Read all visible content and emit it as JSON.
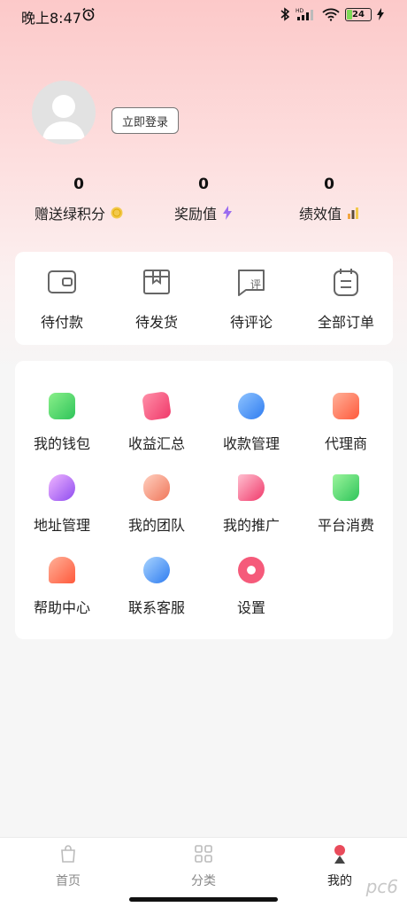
{
  "status_bar": {
    "time": "晚上8:47",
    "battery": "24",
    "network": "HD"
  },
  "profile": {
    "login_label": "立即登录"
  },
  "stats": [
    {
      "value": "0",
      "label": "赠送绿积分",
      "icon": "coin-icon",
      "color": "#f2c94c"
    },
    {
      "value": "0",
      "label": "奖励值",
      "icon": "lightning-icon",
      "color": "#9b6cf0"
    },
    {
      "value": "0",
      "label": "绩效值",
      "icon": "chart-icon",
      "color": "#f2a541"
    }
  ],
  "orders": [
    {
      "label": "待付款",
      "icon": "wallet-icon"
    },
    {
      "label": "待发货",
      "icon": "box-icon"
    },
    {
      "label": "待评论",
      "icon": "review-icon",
      "glyph": "评"
    },
    {
      "label": "全部订单",
      "icon": "order-list-icon"
    }
  ],
  "menu": [
    {
      "label": "我的钱包",
      "icon": "wallet-icon",
      "color": "#4cd964"
    },
    {
      "label": "收益汇总",
      "icon": "income-icon",
      "color": "#f5597e"
    },
    {
      "label": "收款管理",
      "icon": "payment-icon",
      "color": "#3d8bf5"
    },
    {
      "label": "代理商",
      "icon": "agent-icon",
      "color": "#ff7a5c"
    },
    {
      "label": "地址管理",
      "icon": "location-icon",
      "color": "#b06cf0"
    },
    {
      "label": "我的团队",
      "icon": "team-icon",
      "color": "#f39a7a"
    },
    {
      "label": "我的推广",
      "icon": "megaphone-icon",
      "color": "#f55a7a"
    },
    {
      "label": "平台消费",
      "icon": "cart-icon",
      "color": "#4cd964"
    },
    {
      "label": "帮助中心",
      "icon": "help-icon",
      "color": "#ff7a5c"
    },
    {
      "label": "联系客服",
      "icon": "service-icon",
      "color": "#3d8bf5"
    },
    {
      "label": "设置",
      "icon": "gear-icon",
      "color": "#f55a7a"
    }
  ],
  "bottom_nav": [
    {
      "label": "首页",
      "icon": "bag-icon",
      "active": false
    },
    {
      "label": "分类",
      "icon": "grid-icon",
      "active": false
    },
    {
      "label": "我的",
      "icon": "user-icon",
      "active": true
    }
  ],
  "watermark": "pc6"
}
